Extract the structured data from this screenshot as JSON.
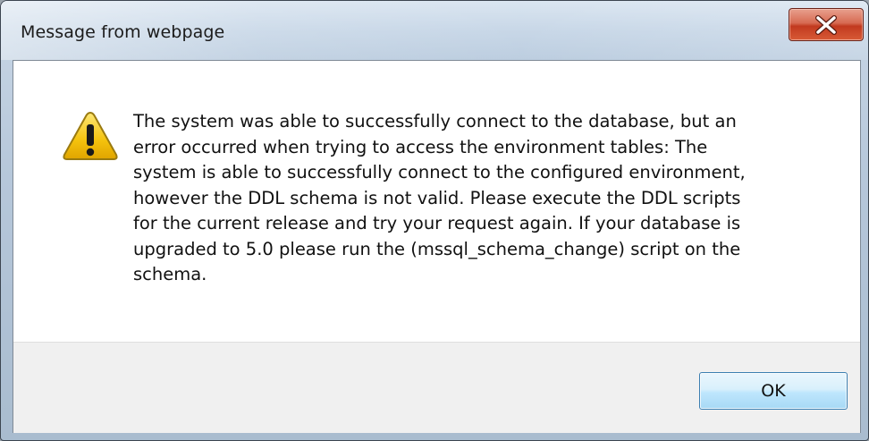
{
  "window": {
    "title": "Message from webpage",
    "close_icon": "close-icon"
  },
  "message": {
    "icon": "warning-icon",
    "lines": [
      "The system was able to successfully connect to the database, but an",
      "error occurred when trying to access the environment tables: The",
      "system is able to successfully connect to the configured environment,",
      "however the DDL schema is not valid.  Please execute the DDL scripts",
      "for the current release and try your request again.  If your database is",
      "upgraded to 5.0 please run the (mssql_schema_change) script on the",
      "schema."
    ]
  },
  "buttons": {
    "ok_label": "OK"
  },
  "colors": {
    "close_button": "#c23a1f",
    "ok_border": "#3c7fb1",
    "warning_fill": "#f4c20d"
  }
}
